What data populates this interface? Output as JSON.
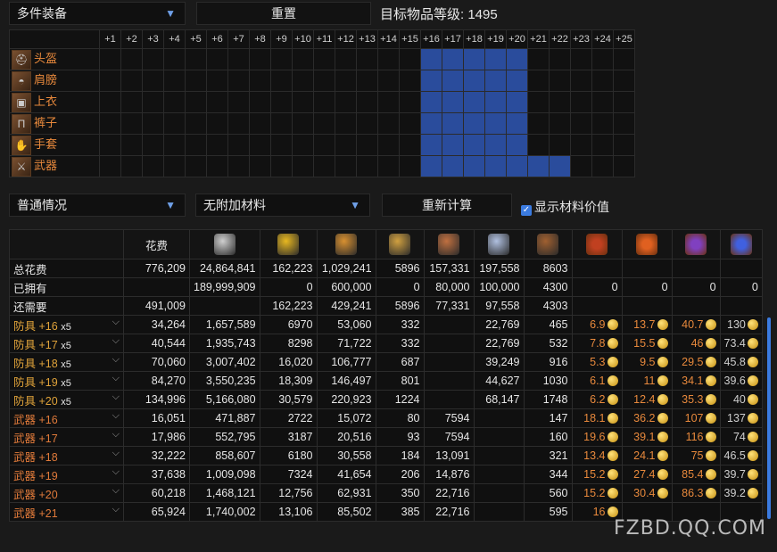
{
  "top": {
    "set_select": "多件装备",
    "reset_label": "重置",
    "target_level": "目标物品等级: 1495"
  },
  "grid": {
    "columns": [
      "+1",
      "+2",
      "+3",
      "+4",
      "+5",
      "+6",
      "+7",
      "+8",
      "+9",
      "+10",
      "+11",
      "+12",
      "+13",
      "+14",
      "+15",
      "+16",
      "+17",
      "+18",
      "+19",
      "+20",
      "+21",
      "+22",
      "+23",
      "+24",
      "+25"
    ],
    "rows": [
      {
        "label": "头盔",
        "icon": "helmet-icon",
        "on_from": 16,
        "on_to": 20
      },
      {
        "label": "肩膀",
        "icon": "shoulder-icon",
        "on_from": 16,
        "on_to": 20
      },
      {
        "label": "上衣",
        "icon": "chest-icon",
        "on_from": 16,
        "on_to": 20
      },
      {
        "label": "裤子",
        "icon": "pants-icon",
        "on_from": 16,
        "on_to": 20
      },
      {
        "label": "手套",
        "icon": "gloves-icon",
        "on_from": 16,
        "on_to": 20
      },
      {
        "label": "武器",
        "icon": "weapon-icon",
        "on_from": 16,
        "on_to": 22
      }
    ]
  },
  "controls": {
    "scenario_select": "普通情况",
    "material_select": "无附加材料",
    "recalc_label": "重新计算",
    "show_value_label": "显示材料价值"
  },
  "table": {
    "cost_header": "花费",
    "summary": [
      {
        "label": "总花费",
        "vals": [
          "776,209",
          "24,864,841",
          "162,223",
          "1,029,241",
          "5896",
          "157,331",
          "197,558",
          "8603",
          "",
          "",
          "",
          ""
        ]
      },
      {
        "label": "已拥有",
        "vals": [
          "",
          "189,999,909",
          "0",
          "600,000",
          "0",
          "80,000",
          "100,000",
          "4300",
          "0",
          "0",
          "0",
          "0"
        ]
      },
      {
        "label": "还需要",
        "vals": [
          "491,009",
          "",
          "162,223",
          "429,241",
          "5896",
          "77,331",
          "97,558",
          "4303",
          "",
          "",
          "",
          ""
        ]
      }
    ],
    "rows": [
      {
        "kind": "armor",
        "name": "防具",
        "lvl": "+16",
        "qty": "x5",
        "vals": [
          "34,264",
          "1,657,589",
          "6970",
          "53,060",
          "332",
          "",
          "22,769",
          "465"
        ],
        "mats": [
          "6.9",
          "13.7",
          "40.7",
          "130"
        ]
      },
      {
        "kind": "armor",
        "name": "防具",
        "lvl": "+17",
        "qty": "x5",
        "vals": [
          "40,544",
          "1,935,743",
          "8298",
          "71,722",
          "332",
          "",
          "22,769",
          "532"
        ],
        "mats": [
          "7.8",
          "15.5",
          "46",
          "73.4"
        ]
      },
      {
        "kind": "armor",
        "name": "防具",
        "lvl": "+18",
        "qty": "x5",
        "vals": [
          "70,060",
          "3,007,402",
          "16,020",
          "106,777",
          "687",
          "",
          "39,249",
          "916"
        ],
        "mats": [
          "5.3",
          "9.5",
          "29.5",
          "45.8"
        ]
      },
      {
        "kind": "armor",
        "name": "防具",
        "lvl": "+19",
        "qty": "x5",
        "vals": [
          "84,270",
          "3,550,235",
          "18,309",
          "146,497",
          "801",
          "",
          "44,627",
          "1030"
        ],
        "mats": [
          "6.1",
          "11",
          "34.1",
          "39.6"
        ]
      },
      {
        "kind": "armor",
        "name": "防具",
        "lvl": "+20",
        "qty": "x5",
        "vals": [
          "134,996",
          "5,166,080",
          "30,579",
          "220,923",
          "1224",
          "",
          "68,147",
          "1748"
        ],
        "mats": [
          "6.2",
          "12.4",
          "35.3",
          "40"
        ]
      },
      {
        "kind": "weap",
        "name": "武器",
        "lvl": "+16",
        "qty": "",
        "vals": [
          "16,051",
          "471,887",
          "2722",
          "15,072",
          "80",
          "7594",
          "",
          "147"
        ],
        "mats": [
          "18.1",
          "36.2",
          "107",
          "137"
        ]
      },
      {
        "kind": "weap",
        "name": "武器",
        "lvl": "+17",
        "qty": "",
        "vals": [
          "17,986",
          "552,795",
          "3187",
          "20,516",
          "93",
          "7594",
          "",
          "160"
        ],
        "mats": [
          "19.6",
          "39.1",
          "116",
          "74"
        ]
      },
      {
        "kind": "weap",
        "name": "武器",
        "lvl": "+18",
        "qty": "",
        "vals": [
          "32,222",
          "858,607",
          "6180",
          "30,558",
          "184",
          "13,091",
          "",
          "321"
        ],
        "mats": [
          "13.4",
          "24.1",
          "75",
          "46.5"
        ]
      },
      {
        "kind": "weap",
        "name": "武器",
        "lvl": "+19",
        "qty": "",
        "vals": [
          "37,638",
          "1,009,098",
          "7324",
          "41,654",
          "206",
          "14,876",
          "",
          "344"
        ],
        "mats": [
          "15.2",
          "27.4",
          "85.4",
          "39.7"
        ]
      },
      {
        "kind": "weap",
        "name": "武器",
        "lvl": "+20",
        "qty": "",
        "vals": [
          "60,218",
          "1,468,121",
          "12,756",
          "62,931",
          "350",
          "22,716",
          "",
          "560"
        ],
        "mats": [
          "15.2",
          "30.4",
          "86.3",
          "39.2"
        ]
      },
      {
        "kind": "weap",
        "name": "武器",
        "lvl": "+21",
        "qty": "",
        "vals": [
          "65,924",
          "1,740,002",
          "13,106",
          "85,502",
          "385",
          "22,716",
          "",
          "595"
        ],
        "mats": [
          "16",
          "",
          "",
          ""
        ]
      }
    ],
    "header_icons": [
      "silver-coin-icon",
      "gold-coin-icon",
      "fragment-icon",
      "leapstone-icon",
      "stone-icon",
      "crystal-icon",
      "fusion-icon",
      "breath-icon-1",
      "breath-icon-2",
      "breath-icon-3",
      "breath-icon-4"
    ],
    "header_colors": [
      "#cfcfcf",
      "#e8b820",
      "#d89030",
      "#d0a040",
      "#c07040",
      "#b0c0e0",
      "#a06030",
      "#c04020",
      "#e06020",
      "#8040c0",
      "#4060e0"
    ]
  },
  "watermark": "FZBD.QQ.COM"
}
